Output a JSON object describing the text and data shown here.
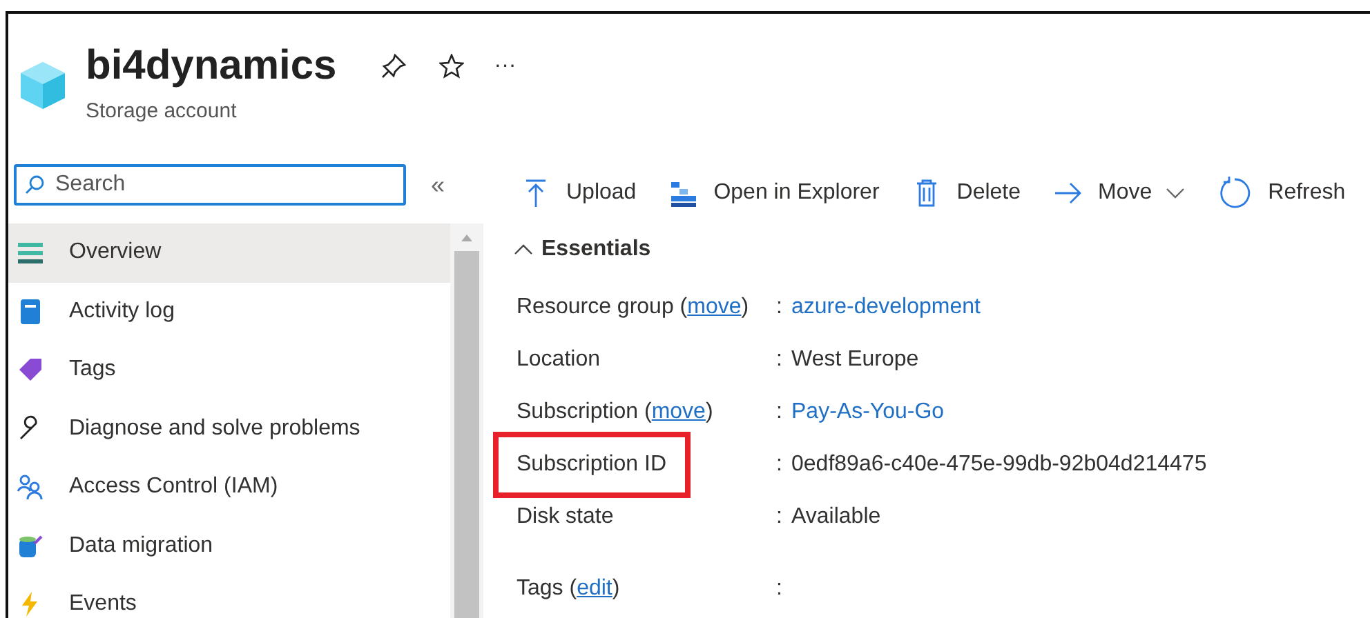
{
  "header": {
    "title": "bi4dynamics",
    "subtitle": "Storage account",
    "more": "···"
  },
  "sidebar": {
    "search": {
      "placeholder": "Search"
    },
    "collapse": "«",
    "items": [
      {
        "label": "Overview",
        "selected": true
      },
      {
        "label": "Activity log",
        "selected": false
      },
      {
        "label": "Tags",
        "selected": false
      },
      {
        "label": "Diagnose and solve problems",
        "selected": false
      },
      {
        "label": "Access Control (IAM)",
        "selected": false
      },
      {
        "label": "Data migration",
        "selected": false
      },
      {
        "label": "Events",
        "selected": false
      }
    ]
  },
  "toolbar": [
    {
      "label": "Upload"
    },
    {
      "label": "Open in Explorer"
    },
    {
      "label": "Delete"
    },
    {
      "label": "Move"
    },
    {
      "label": "Refresh"
    }
  ],
  "essentials": {
    "title": "Essentials",
    "expanded": true,
    "rows": [
      {
        "label": "Resource group",
        "paren_open": "(",
        "link": "move",
        "paren_close": ")",
        "colon": ":",
        "value": "azure-development",
        "value_link": true,
        "highlighted": false
      },
      {
        "label": "Location",
        "colon": ":",
        "value": "West Europe",
        "value_link": false,
        "highlighted": false
      },
      {
        "label": "Subscription",
        "paren_open": "(",
        "link": "move",
        "paren_close": ")",
        "colon": ":",
        "value": "Pay-As-You-Go",
        "value_link": true,
        "highlighted": false
      },
      {
        "label": "Subscription ID",
        "colon": ":",
        "value": "0edf89a6-c40e-475e-99db-92b04d214475",
        "value_link": false,
        "highlighted": true
      },
      {
        "label": "Disk state",
        "colon": ":",
        "value": "Available",
        "value_link": false,
        "highlighted": false
      },
      {
        "label": "Tags",
        "paren_open": "(",
        "link": "edit",
        "paren_close": ")",
        "colon": ":",
        "highlighted": false
      }
    ]
  }
}
